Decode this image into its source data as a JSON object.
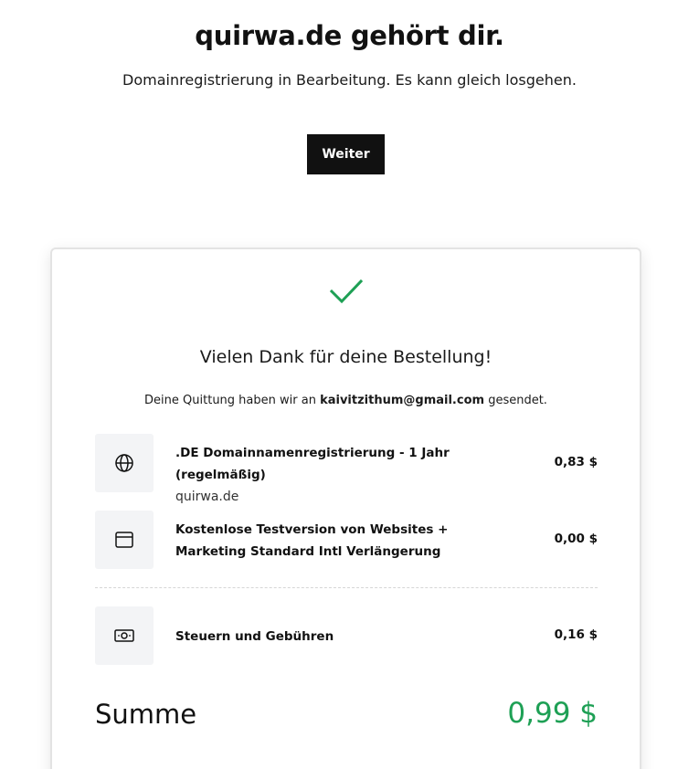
{
  "header": {
    "title": "quirwa.de gehört dir.",
    "subtitle": "Domainregistrierung in Bearbeitung. Es kann gleich losgehen.",
    "continue_label": "Weiter"
  },
  "confirmation": {
    "check_icon": "checkmark-icon",
    "thanks": "Vielen Dank für deine Bestellung!",
    "receipt_prefix": "Deine Quittung haben wir an",
    "receipt_email": "kaivitzithum@gmail.com",
    "receipt_suffix": "gesendet."
  },
  "items": [
    {
      "icon": "globe-icon",
      "title": ".DE Domainnamenregistrierung - 1 Jahr (regelmäßig)",
      "subtitle": "quirwa.de",
      "price": "0,83 $"
    },
    {
      "icon": "browser-window-icon",
      "title": "Kostenlose Testversion von Websites + Marketing Standard Intl Verlängerung",
      "subtitle": "",
      "price": "0,00 $"
    },
    {
      "icon": "money-icon",
      "title": "Steuern und Gebühren",
      "subtitle": "",
      "price": "0,16 $"
    }
  ],
  "total": {
    "label": "Summe",
    "value": "0,99 $"
  },
  "colors": {
    "accent_green": "#1ea055",
    "button_bg": "#111111",
    "icon_box_bg": "#f3f4f6"
  }
}
